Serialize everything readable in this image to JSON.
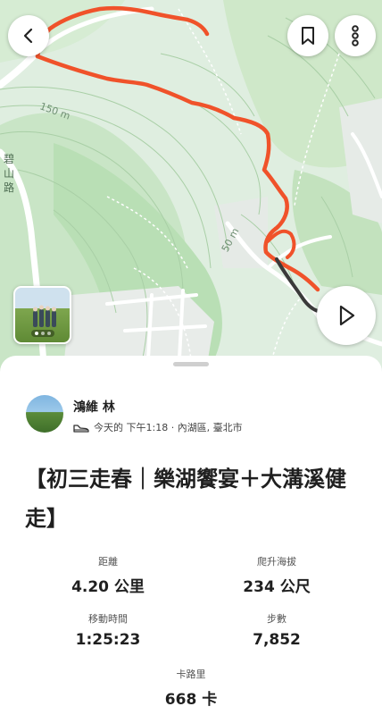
{
  "map": {
    "road_label": "碧山路",
    "contour_labels": [
      "150 m",
      "50 m"
    ],
    "route_color": "#f0522a",
    "route_tail_color": "#3a3a3a"
  },
  "header": {
    "back_icon": "chevron-left-icon",
    "bookmark_icon": "bookmark-icon",
    "more_icon": "more-vertical-icon"
  },
  "play_icon": "play-icon",
  "photo": {
    "count": 3,
    "active_index": 0
  },
  "activity": {
    "user_name": "鴻維 林",
    "type_icon": "shoe-icon",
    "meta": "今天的 下午1:18 · 內湖區, 臺北市",
    "title": "【初三走春｜樂湖饗宴＋大溝溪健走】",
    "stats": {
      "distance": {
        "label": "距離",
        "value": "4.20 公里"
      },
      "elevation": {
        "label": "爬升海拔",
        "value": "234 公尺"
      },
      "moving_time": {
        "label": "移動時間",
        "value": "1:25:23"
      },
      "steps": {
        "label": "步數",
        "value": "7,852"
      },
      "calories": {
        "label": "卡路里",
        "value": "668 卡"
      }
    }
  }
}
